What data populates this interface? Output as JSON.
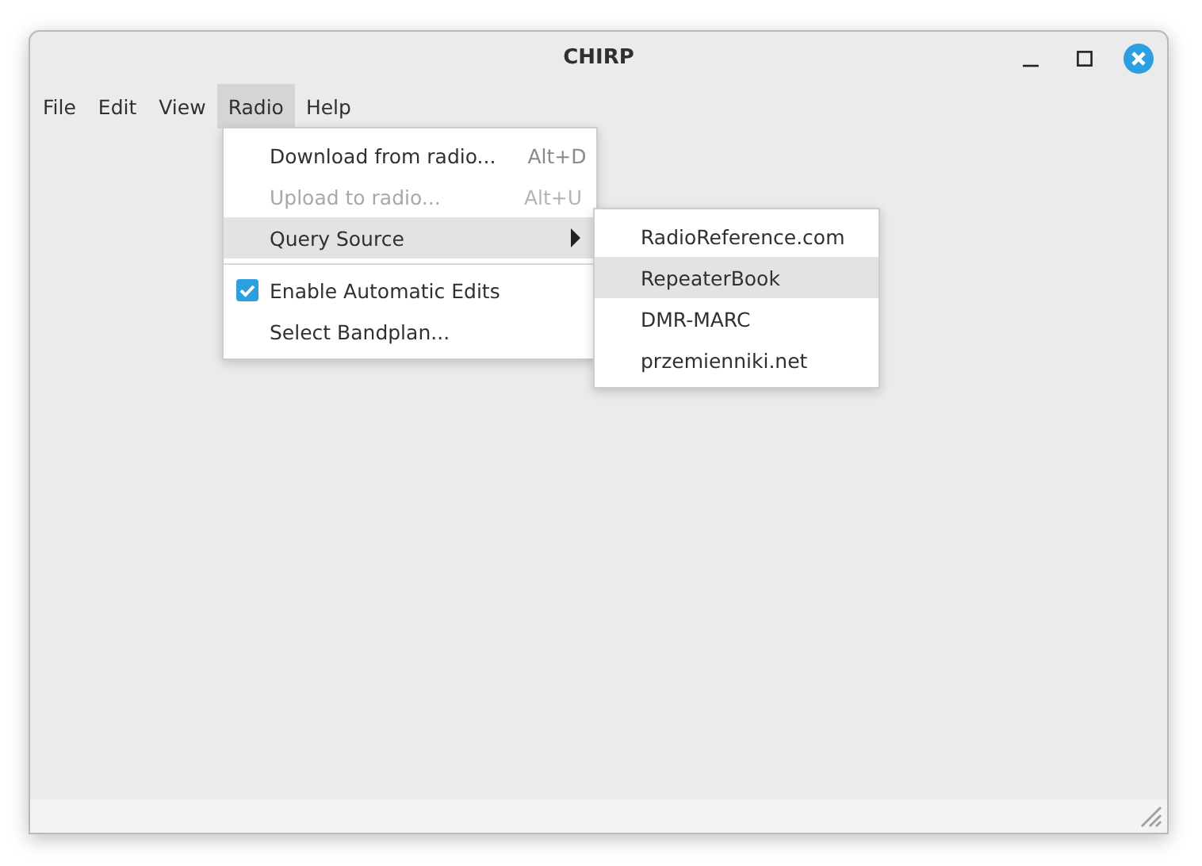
{
  "window": {
    "title": "CHIRP"
  },
  "menubar": [
    {
      "label": "File",
      "selected": false
    },
    {
      "label": "Edit",
      "selected": false
    },
    {
      "label": "View",
      "selected": false
    },
    {
      "label": "Radio",
      "selected": true
    },
    {
      "label": "Help",
      "selected": false
    }
  ],
  "radio_menu": [
    {
      "kind": "command",
      "label": "Download from radio...",
      "shortcut": "Alt+D",
      "disabled": false,
      "selected": false
    },
    {
      "kind": "command",
      "label": "Upload to radio...",
      "shortcut": "Alt+U",
      "disabled": true,
      "selected": false
    },
    {
      "kind": "submenu",
      "label": "Query Source",
      "disabled": false,
      "selected": true
    },
    {
      "kind": "separator"
    },
    {
      "kind": "check",
      "label": "Enable Automatic Edits",
      "checked": true,
      "disabled": false,
      "selected": false
    },
    {
      "kind": "command",
      "label": "Select Bandplan...",
      "disabled": false,
      "selected": false
    }
  ],
  "query_source_menu": [
    {
      "label": "RadioReference.com",
      "selected": false
    },
    {
      "label": "RepeaterBook",
      "selected": true
    },
    {
      "label": "DMR-MARC",
      "selected": false
    },
    {
      "label": "przemienniki.net",
      "selected": false
    }
  ]
}
